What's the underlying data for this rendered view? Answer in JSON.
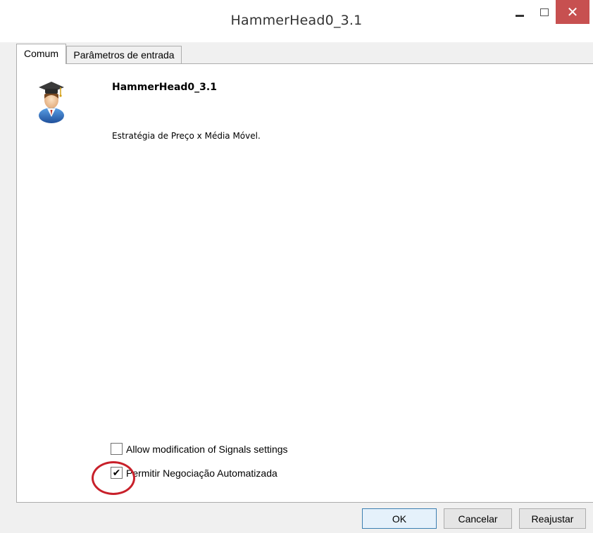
{
  "window": {
    "title": "HammerHead0_3.1",
    "controls": [
      "minimize-icon",
      "maximize-icon",
      "close-icon"
    ],
    "close_glyph": "✕"
  },
  "tabs": [
    {
      "label": "Comum",
      "active": true
    },
    {
      "label": "Parâmetros de entrada",
      "active": false
    }
  ],
  "expert": {
    "icon": "graduate-user-icon",
    "name": "HammerHead0_3.1",
    "description": "Estratégia de Preço x Média Móvel."
  },
  "options": [
    {
      "label": "Allow modification of Signals settings",
      "checked": false,
      "mark": ""
    },
    {
      "label": "Permitir Negociação Automatizada",
      "checked": true,
      "mark": "✔"
    }
  ],
  "buttons": {
    "ok": "OK",
    "cancel": "Cancelar",
    "reset": "Reajustar"
  },
  "colors": {
    "close_button": "#c75050",
    "annotation": "#c8202a",
    "ok_border": "#3c7fb1"
  }
}
